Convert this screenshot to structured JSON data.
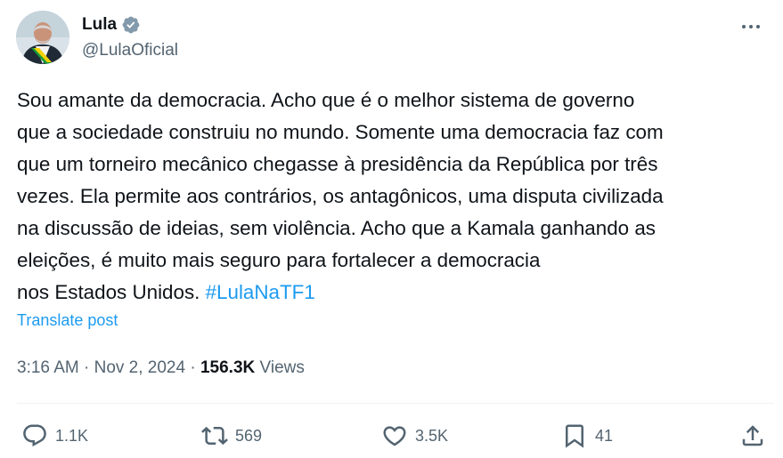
{
  "author": {
    "display_name": "Lula",
    "handle": "@LulaOficial",
    "verified": true
  },
  "post": {
    "text": "Sou amante da democracia. Acho que é o melhor sistema de governo\nque a sociedade construiu no mundo. Somente uma democracia faz com\nque um torneiro mecânico chegasse à presidência da República por três\nvezes. Ela permite aos contrários, os antagônicos, uma disputa civilizada\nna discussão de ideias, sem violência. Acho que a Kamala ganhando as\neleições, é muito mais seguro para fortalecer a democracia\nnos Estados Unidos. ",
    "hashtag": "#LulaNaTF1",
    "translate_label": "Translate post"
  },
  "meta": {
    "time": "3:16 AM",
    "separator": "·",
    "date": "Nov 2, 2024",
    "views_count": "156.3K",
    "views_label": "Views"
  },
  "actions": {
    "replies": "1.1K",
    "reposts": "569",
    "likes": "3.5K",
    "bookmarks": "41"
  },
  "colors": {
    "accent": "#1d9bf0",
    "text": "#0f1419",
    "secondary": "#536471",
    "divider": "#eff3f4"
  }
}
